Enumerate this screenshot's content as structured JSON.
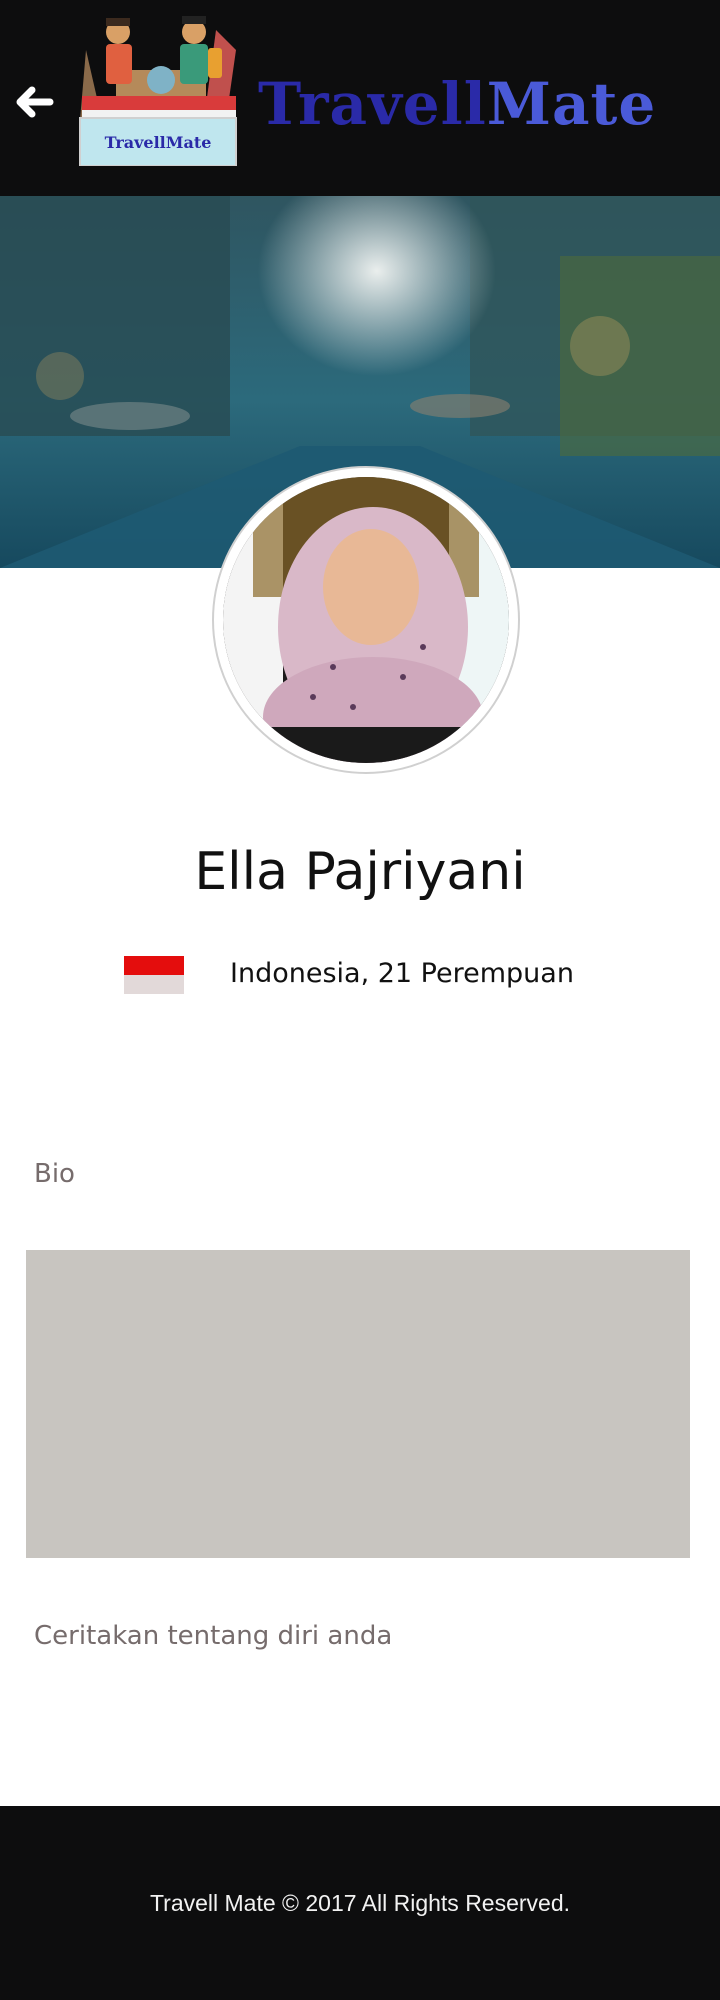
{
  "header": {
    "back_icon": "arrow-left-icon",
    "logo_badge_text": "TravellMate",
    "brand": {
      "part1": "Travell",
      "part2": "Mate"
    },
    "colors": {
      "bar": "#0d0d0e",
      "brand_dark": "#2a2aa8",
      "brand_light": "#4a5ad8"
    }
  },
  "profile": {
    "name": "Ella Pajriyani",
    "flag_icon": "indonesia-flag-icon",
    "country_info": "Indonesia, 21 Perempuan"
  },
  "bio": {
    "label": "Bio",
    "placeholder": "Ceritakan tentang diri anda",
    "box_color": "#c8c5c0"
  },
  "footer": {
    "text": "Travell Mate © 2017 All Rights Reserved."
  }
}
